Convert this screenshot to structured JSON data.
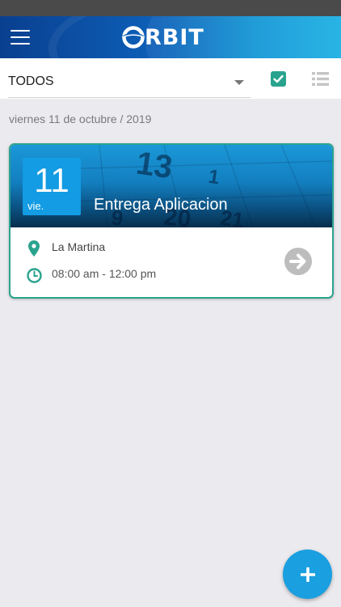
{
  "header": {
    "logo_text": "RBIT",
    "logo_alt": "ORBIT",
    "background": "#0d5fb8"
  },
  "filter": {
    "selected": "TODOS"
  },
  "date_header": "viernes 11 de octubre / 2019",
  "event": {
    "day_number": "11",
    "day_abbr": "vie.",
    "title": "Entrega Aplicacion",
    "location": "La Martina",
    "time": "08:00 am - 12:00 pm",
    "border_color": "#2aa38e"
  },
  "colors": {
    "accent": "#1a9fe0",
    "teal": "#2aa38e",
    "background": "#ebeaef"
  },
  "icons": {
    "menu": "hamburger-menu-icon",
    "check": "checkbox-checked-icon",
    "list": "list-view-icon",
    "location": "map-pin-icon",
    "time": "clock-icon",
    "go": "arrow-right-circle-icon",
    "add": "plus-icon"
  }
}
